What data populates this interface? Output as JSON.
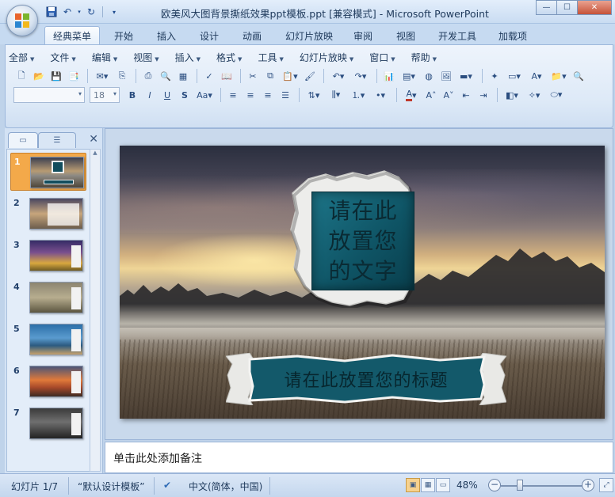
{
  "window": {
    "title": "欧美风大图背景撕纸效果ppt模板.ppt [兼容模式] - Microsoft PowerPoint",
    "controls": {
      "minimize": "—",
      "maximize": "☐",
      "close": "✕"
    }
  },
  "quick_access": {
    "save_icon": "save-icon",
    "undo_icon": "undo-icon",
    "redo_icon": "redo-icon"
  },
  "ribbon_tabs": [
    {
      "label": "经典菜单",
      "active": true
    },
    {
      "label": "开始"
    },
    {
      "label": "插入"
    },
    {
      "label": "设计"
    },
    {
      "label": "动画"
    },
    {
      "label": "幻灯片放映"
    },
    {
      "label": "审阅"
    },
    {
      "label": "视图"
    },
    {
      "label": "开发工具"
    },
    {
      "label": "加载项"
    }
  ],
  "classic_menu": [
    "全部",
    "文件",
    "编辑",
    "视图",
    "插入",
    "格式",
    "工具",
    "幻灯片放映",
    "窗口",
    "帮助"
  ],
  "format_bar": {
    "font_name": "",
    "font_size": "18"
  },
  "slide_panel": {
    "thumbnails": [
      {
        "num": "1",
        "selected": true
      },
      {
        "num": "2"
      },
      {
        "num": "3"
      },
      {
        "num": "4"
      },
      {
        "num": "5"
      },
      {
        "num": "6"
      },
      {
        "num": "7"
      }
    ]
  },
  "slide": {
    "main_text": "请在此放置您的文字",
    "main_text_lines": [
      "请在此",
      "放置您",
      "的文字"
    ],
    "title_text": "请在此放置您的标题"
  },
  "notes": {
    "placeholder": "单击此处添加备注"
  },
  "status_bar": {
    "slide_counter": "幻灯片 1/7",
    "theme": "“默认设计模板”",
    "language": "中文(简体，中国)",
    "zoom": "48%"
  },
  "colors": {
    "accent_teal": "#0f5566",
    "selected_thumb": "#f3a94a",
    "ribbon_bg": "#dde9f7"
  }
}
